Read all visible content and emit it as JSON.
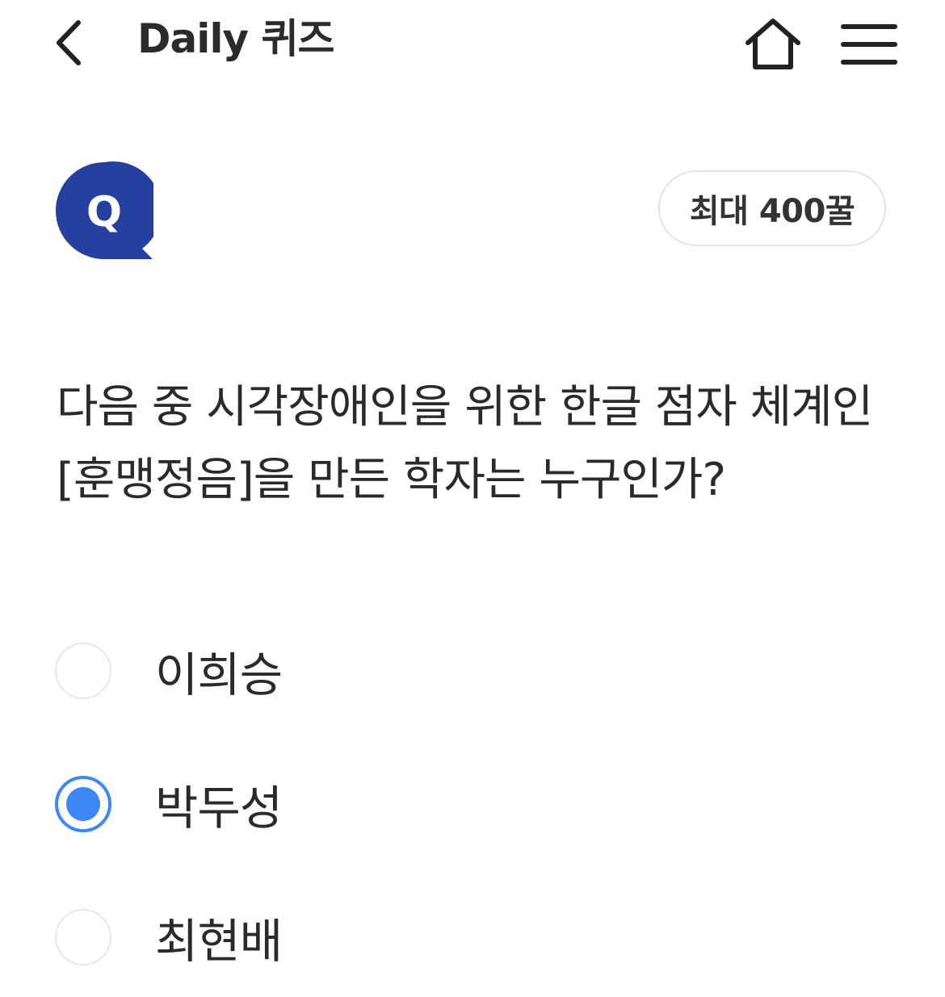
{
  "header": {
    "title": "Daily 퀴즈",
    "back_icon": "chevron-left-icon",
    "home_icon": "home-icon",
    "menu_icon": "hamburger-menu-icon"
  },
  "quiz": {
    "badge_label": "Q",
    "badge_color": "#25409f",
    "reward": "최대 400꿀",
    "question": "다음 중 시각장애인을 위한 한글 점자 체계인 [훈맹정음]을 만든 학자는 누구인가?",
    "options": [
      {
        "label": "이희승",
        "selected": false
      },
      {
        "label": "박두성",
        "selected": true
      },
      {
        "label": "최현배",
        "selected": false
      }
    ],
    "accent_color": "#3d86f5"
  }
}
